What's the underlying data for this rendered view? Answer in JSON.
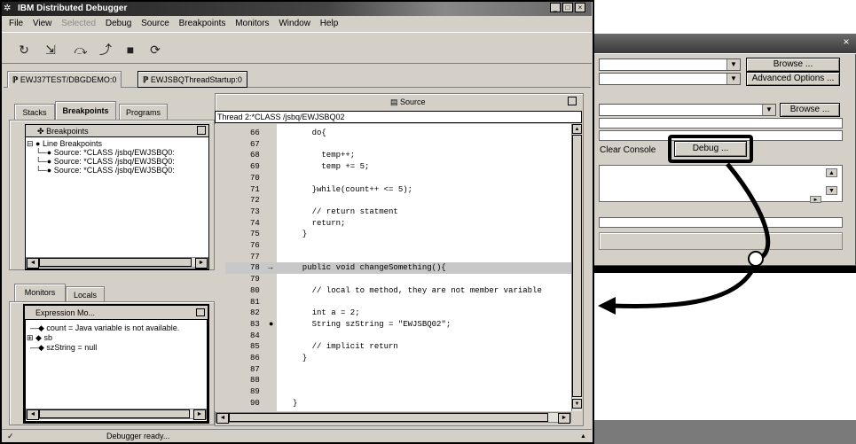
{
  "window": {
    "title": "IBM Distributed Debugger",
    "menus": [
      "File",
      "View",
      "Selected",
      "Debug",
      "Source",
      "Breakpoints",
      "Monitors",
      "Window",
      "Help"
    ],
    "disabled_menus": [
      "Selected"
    ]
  },
  "toolbar": {
    "icons": [
      "step-over-icon",
      "step-into-icon",
      "step-debug-icon",
      "step-return-icon",
      "stop-icon",
      "restart-icon"
    ]
  },
  "program_tabs": [
    "EWJ37TEST/DBGDEMO:0",
    "EWJSBQThreadStartup:0"
  ],
  "left_tabs": [
    "Stacks",
    "Breakpoints",
    "Programs"
  ],
  "breakpoints": {
    "header": "Breakpoints",
    "group": "Line Breakpoints",
    "items": [
      "Source: *CLASS   /jsbq/EWJSBQ0:",
      "Source: *CLASS   /jsbq/EWJSBQ0:",
      "Source: *CLASS   /jsbq/EWJSBQ0:"
    ]
  },
  "monitor_tabs": [
    "Monitors",
    "Locals"
  ],
  "monitors": {
    "header": "Expression Mo...",
    "items": [
      "count = Java variable is not available.",
      "sb",
      "szString = null"
    ]
  },
  "source": {
    "header": "Source",
    "thread_label": "Thread 2:*CLASS   /jsbq/EWJSBQ02",
    "current_line": 78,
    "breakpoint_line": 83,
    "lines": [
      {
        "n": "66",
        "code": "    do{"
      },
      {
        "n": "67",
        "code": ""
      },
      {
        "n": "68",
        "code": "      temp++;"
      },
      {
        "n": "69",
        "code": "      temp += 5;"
      },
      {
        "n": "70",
        "code": ""
      },
      {
        "n": "71",
        "code": "    }while(count++ <= 5);"
      },
      {
        "n": "72",
        "code": ""
      },
      {
        "n": "73",
        "code": "    // return statment"
      },
      {
        "n": "74",
        "code": "    return;"
      },
      {
        "n": "75",
        "code": "  }"
      },
      {
        "n": "76",
        "code": ""
      },
      {
        "n": "77",
        "code": ""
      },
      {
        "n": "78",
        "code": "  public void changeSomething(){"
      },
      {
        "n": "79",
        "code": ""
      },
      {
        "n": "80",
        "code": "    // local to method, they are not member variable"
      },
      {
        "n": "81",
        "code": ""
      },
      {
        "n": "82",
        "code": "    int a = 2;"
      },
      {
        "n": "83",
        "code": "    String szString = \"EWJSBQ02\";"
      },
      {
        "n": "84",
        "code": ""
      },
      {
        "n": "85",
        "code": "    // implicit return"
      },
      {
        "n": "86",
        "code": "  }"
      },
      {
        "n": "87",
        "code": ""
      },
      {
        "n": "88",
        "code": ""
      },
      {
        "n": "89",
        "code": ""
      },
      {
        "n": "90",
        "code": "}"
      }
    ]
  },
  "status": {
    "text": "Debugger ready...",
    "check": "✓"
  },
  "dialog": {
    "browse1": "Browse ...",
    "advanced": "Advanced Options ...",
    "browse2": "Browse ...",
    "clear_console": "Clear Console",
    "debug": "Debug ...",
    "close": "×"
  },
  "colors": {
    "highlight_box": "#000000",
    "arrow": "#000000",
    "current_line_bg": "#c8c8c8",
    "status_bar": "#7a7a7a"
  }
}
